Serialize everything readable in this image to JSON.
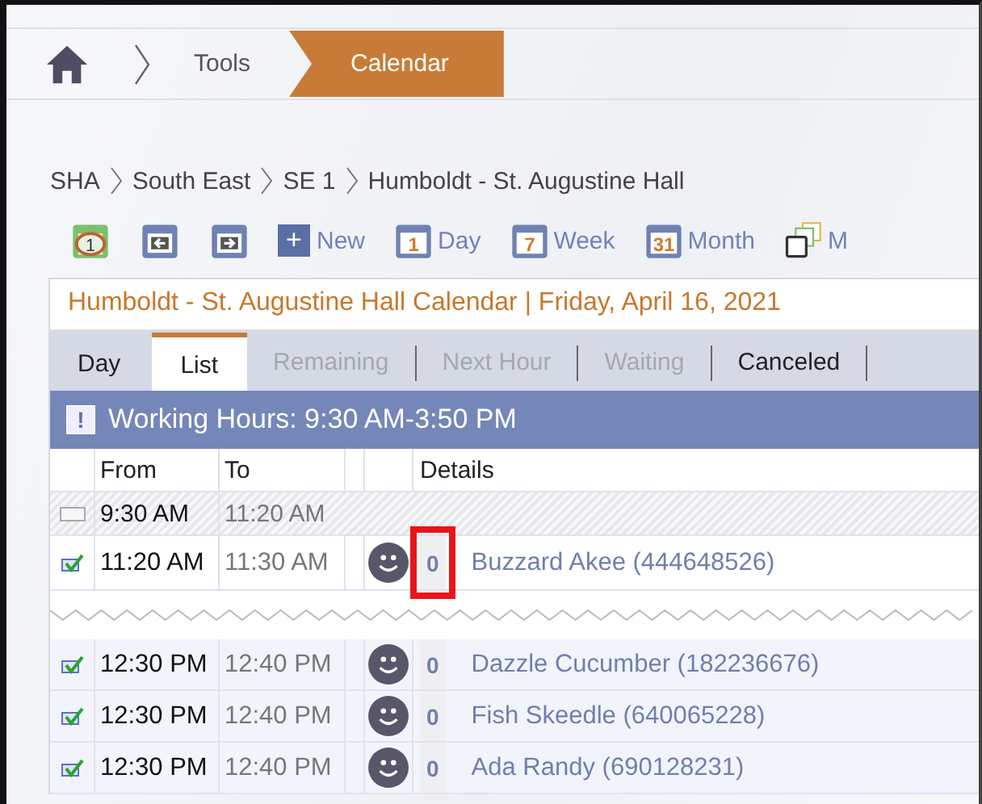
{
  "nav": {
    "crumbs": [
      {
        "label": "Tools",
        "selected": false
      },
      {
        "label": "Calendar",
        "selected": true
      }
    ]
  },
  "breadcrumb": [
    "SHA",
    "South East",
    "SE 1",
    "Humboldt - St. Augustine Hall"
  ],
  "toolbar": [
    {
      "kind": "today",
      "badge": "1"
    },
    {
      "kind": "prev"
    },
    {
      "kind": "next"
    },
    {
      "kind": "new",
      "badge": "+",
      "label": "New"
    },
    {
      "kind": "cal",
      "badge": "1",
      "label": "Day"
    },
    {
      "kind": "cal",
      "badge": "7",
      "label": "Week"
    },
    {
      "kind": "cal",
      "badge": "31",
      "label": "Month"
    },
    {
      "kind": "multi",
      "label": "M"
    }
  ],
  "title": "Humboldt - St. Augustine Hall Calendar | Friday, April 16, 2021",
  "tabs": [
    {
      "label": "Day",
      "selected": false,
      "disabled": false
    },
    {
      "label": "List",
      "selected": true,
      "disabled": false
    },
    {
      "label": "Remaining",
      "selected": false,
      "disabled": true
    },
    {
      "label": "Next Hour",
      "selected": false,
      "disabled": true
    },
    {
      "label": "Waiting",
      "selected": false,
      "disabled": true
    },
    {
      "label": "Canceled",
      "selected": false,
      "disabled": false
    }
  ],
  "banner": {
    "icon": "!",
    "text": "Working Hours: 9:30 AM-3:50 PM"
  },
  "columns": [
    "From",
    "To",
    "Details"
  ],
  "rows": [
    {
      "kind": "free",
      "from": "9:30 AM",
      "to": "11:20 AM"
    },
    {
      "kind": "appointment",
      "checked": true,
      "from": "11:20 AM",
      "to": "11:30 AM",
      "count": "0",
      "name": "Buzzard Akee (444648526)",
      "highlighted": true
    },
    {
      "kind": "gap"
    },
    {
      "kind": "appointment",
      "checked": true,
      "from": "12:30 PM",
      "to": "12:40 PM",
      "count": "0",
      "name": "Dazzle Cucumber (182236676)",
      "highlighted": false
    },
    {
      "kind": "appointment",
      "checked": true,
      "from": "12:30 PM",
      "to": "12:40 PM",
      "count": "0",
      "name": "Fish Skeedle (640065228)",
      "highlighted": false
    },
    {
      "kind": "appointment",
      "checked": true,
      "from": "12:30 PM",
      "to": "12:40 PM",
      "count": "0",
      "name": "Ada Randy (690128231)",
      "highlighted": false
    }
  ]
}
